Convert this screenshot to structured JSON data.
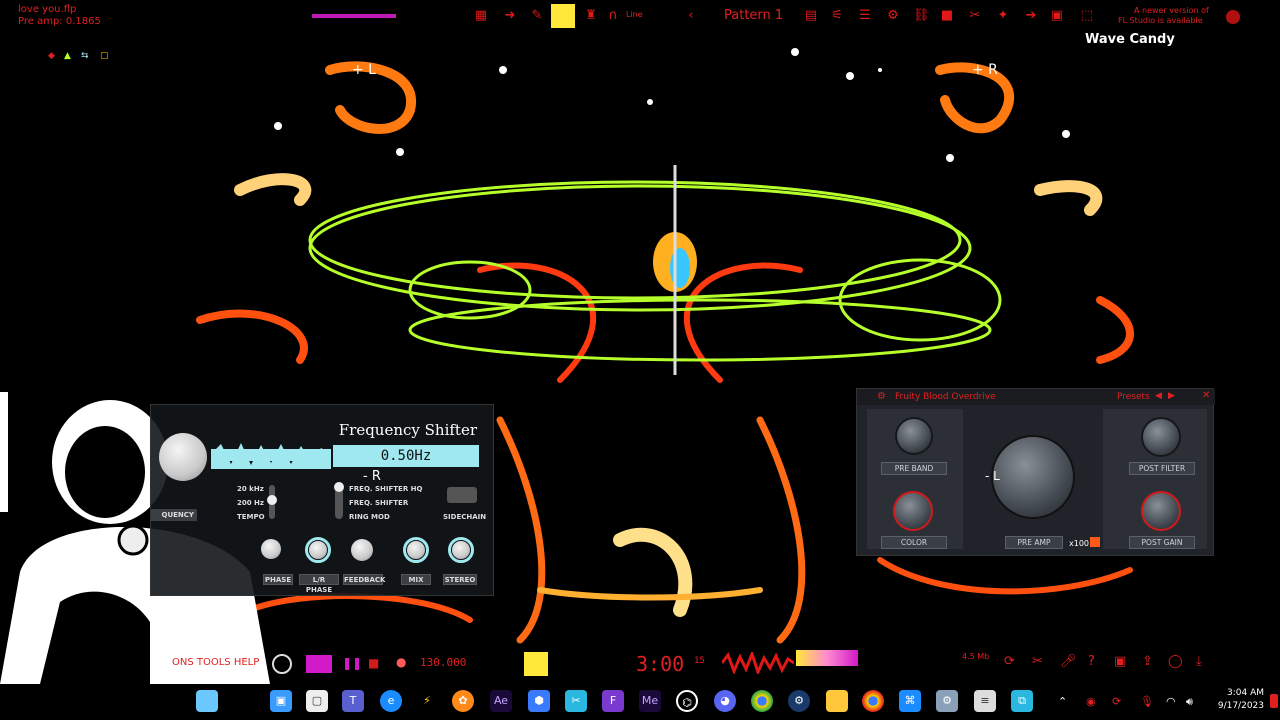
{
  "colors": {
    "accent_red": "#e01818",
    "cyan": "#9fe8ef",
    "lime": "#b6ff2a"
  },
  "overlay": {
    "file_name": "love you.flp",
    "pre_amp_readout": "Pre amp: 0.1865",
    "wave_candy": "Wave Candy",
    "label_plus_l": "+ L",
    "label_plus_r": "+ R",
    "label_minus_r": "- R",
    "label_minus_l": "- L",
    "corner_text_1": "A newer version of",
    "corner_text_2": "FL Studio is available"
  },
  "toolbar": {
    "pattern_label": "Pattern 1",
    "line_label": "Line",
    "icons": [
      "piano-roll-icon",
      "arrow-icon",
      "brush-icon",
      "highlight-icon",
      "stamp-icon",
      "magnet-icon",
      "chevron-icon",
      "playlist-icon",
      "channel-rack-icon",
      "mixer-icon",
      "plugin-icon",
      "browser-icon",
      "record-icon",
      "scissors-icon",
      "arrow-right-icon",
      "cpu-icon"
    ]
  },
  "freq_shifter": {
    "title": "Frequency Shifter",
    "display_value": "0.50Hz",
    "range_high": "20 kHz",
    "range_low": "200 Hz",
    "tempo": "TEMPO",
    "frequency_tab": "QUENCY",
    "modes": [
      "FREQ. SHIFTER HQ",
      "FREQ. SHIFTER",
      "RING MOD"
    ],
    "sidechain": "SIDECHAIN",
    "knob_labels": [
      "PHASE",
      "L/R PHASE",
      "FEEDBACK",
      "MIX",
      "STEREO"
    ]
  },
  "fbo": {
    "title": "Fruity Blood Overdrive",
    "presets": "Presets",
    "labels": {
      "pre_band": "PRE BAND",
      "color": "COLOR",
      "pre_amp": "PRE AMP",
      "x100": "x100",
      "post_filter": "POST FILTER",
      "post_gain": "POST GAIN"
    }
  },
  "transport": {
    "menu_text": "ONS TOOLS HELP",
    "tempo": "130.000",
    "time": "3:00",
    "time_sub": "15",
    "bar_readout": "4.5 Mb"
  },
  "taskbar": {
    "apps": [
      "file-explorer-icon",
      "terminal-icon",
      "teams-icon",
      "edge-icon",
      "bolt-icon",
      "fl-studio-icon",
      "after-effects-icon",
      "shield-app-icon",
      "snip-icon",
      "onenote-icon",
      "media-encoder-icon",
      "chatgpt-icon",
      "discord-icon",
      "chrome-icon",
      "steam-icon",
      "folder-icon",
      "chrome-dev-icon",
      "remote-icon",
      "settings-icon",
      "notes-icon",
      "photos-icon"
    ],
    "ae_label": "Ae",
    "me_label": "Me",
    "clock_time": "3:04 AM",
    "clock_date": "9/17/2023"
  }
}
